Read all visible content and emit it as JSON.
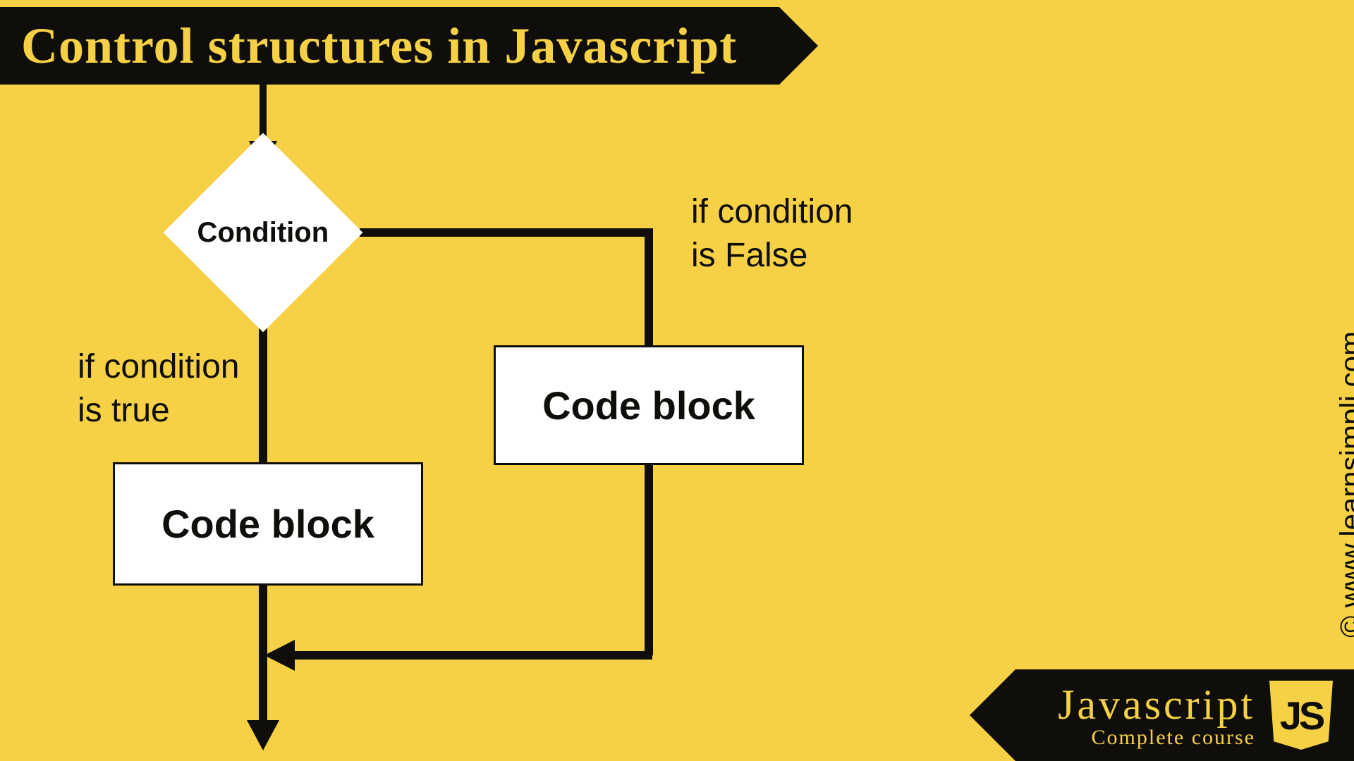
{
  "title": "Control structures in Javascript",
  "diagram": {
    "condition": "Condition",
    "true_label": "if condition\nis true",
    "false_label": "if condition\nis False",
    "true_block": "Code block",
    "false_block": "Code block"
  },
  "watermark": "© www.learnsimpli.com",
  "footer": {
    "main": "Javascript",
    "sub": "Complete course",
    "badge": "JS"
  }
}
